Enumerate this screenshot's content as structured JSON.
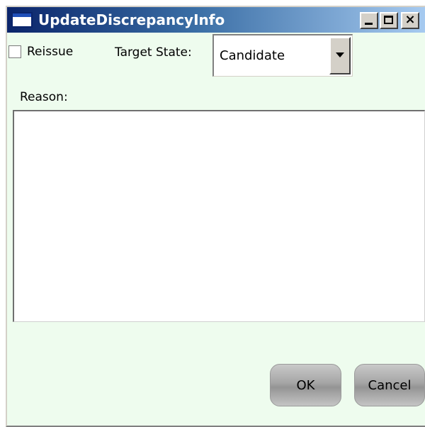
{
  "window": {
    "title": "UpdateDiscrepancyInfo",
    "titlebar_buttons": [
      "minimize-icon",
      "maximize-icon",
      "close-icon"
    ]
  },
  "form": {
    "reissue_label": "Reissue",
    "reissue_checked": false,
    "target_state_label": "Target State:",
    "target_state_value": "Candidate",
    "reason_label": "Reason:",
    "reason_value": ""
  },
  "buttons": {
    "ok_label": "OK",
    "cancel_label": "Cancel"
  },
  "colors": {
    "dialog_background": "#eefcee",
    "titlebar_start": "#0a246a",
    "titlebar_end": "#a6caf0"
  }
}
